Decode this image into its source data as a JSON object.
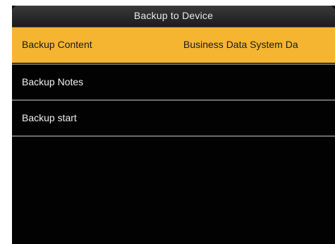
{
  "title_bar": {
    "title": "Backup to Device"
  },
  "menu": {
    "items": [
      {
        "label": "Backup Content",
        "value": "Business Data System Da"
      },
      {
        "label": "Backup Notes"
      },
      {
        "label": "Backup start"
      }
    ],
    "selected_index": 0
  },
  "colors": {
    "highlight": "#f5b531",
    "background": "#020202",
    "text": "#f0f0f0"
  }
}
